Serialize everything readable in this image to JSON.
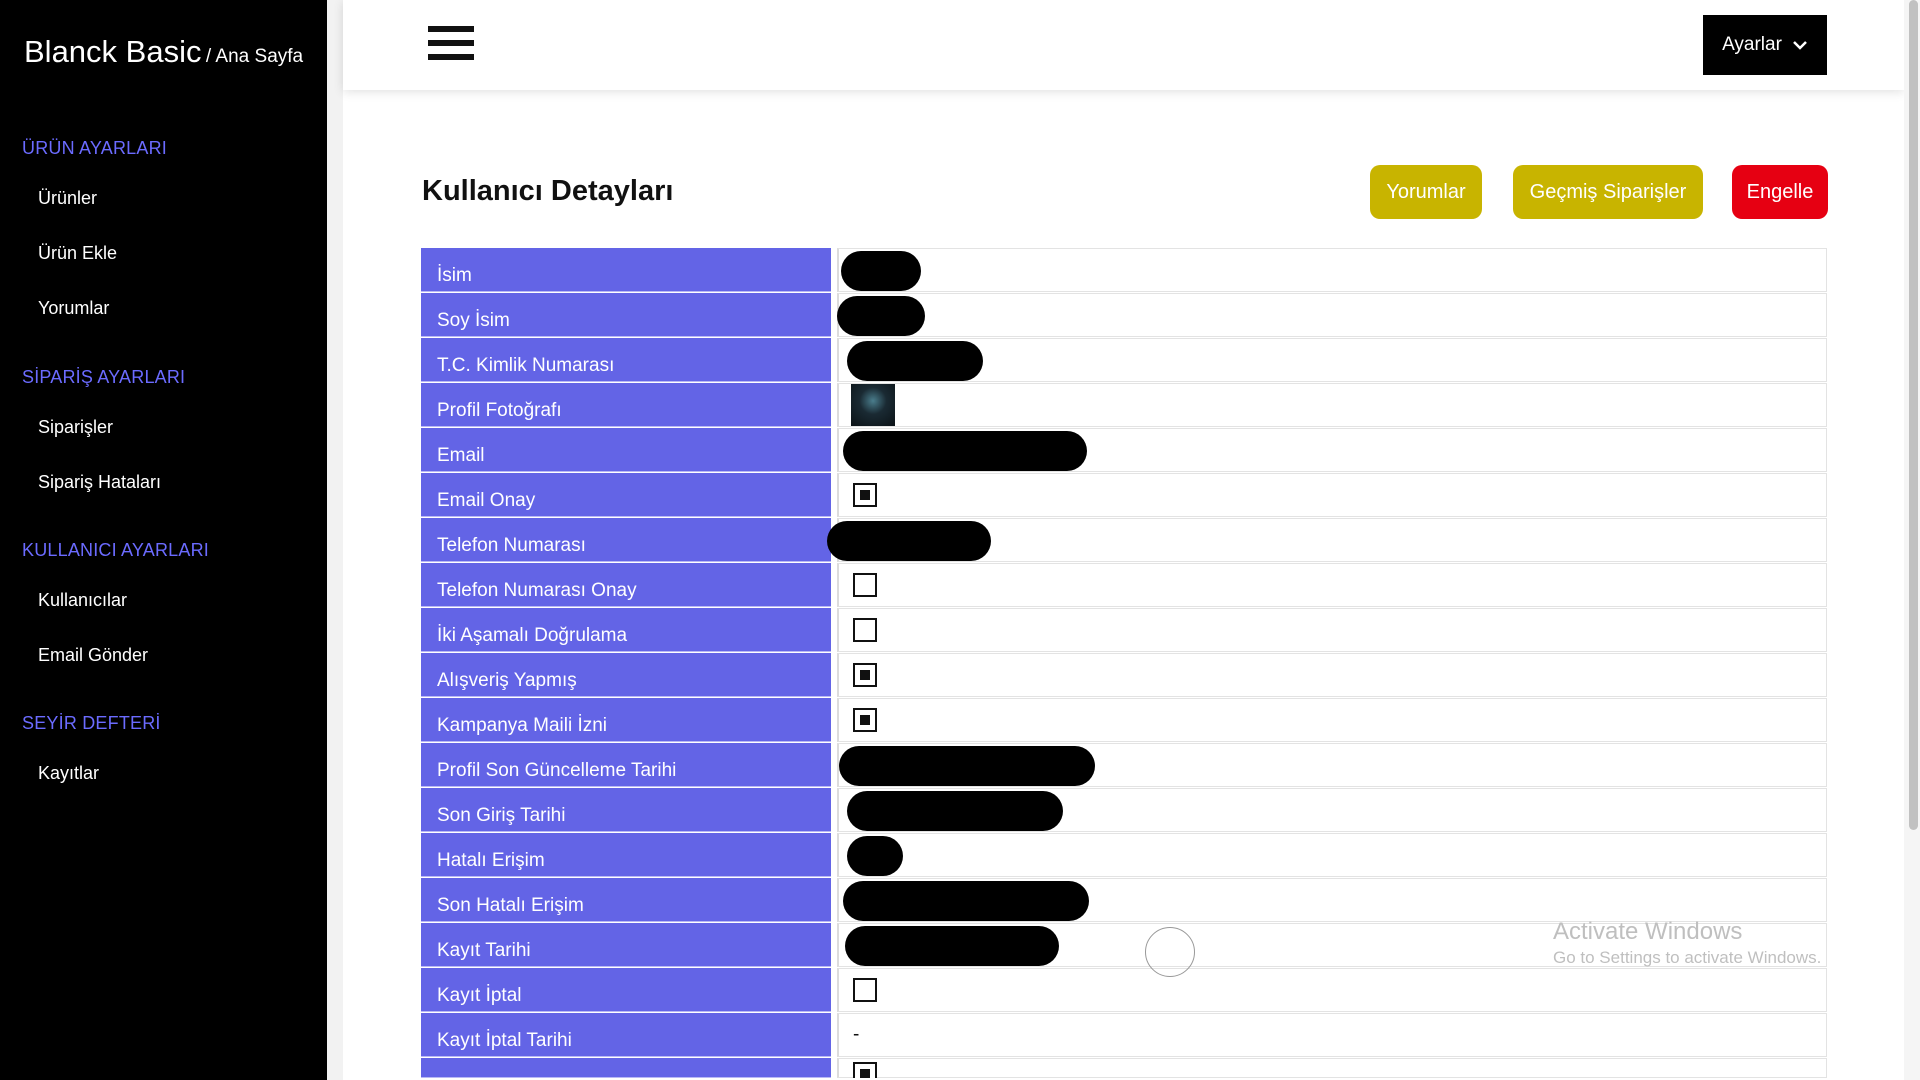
{
  "sidebar": {
    "brand_title": "Blanck Basic",
    "brand_sub": "/ Ana Sayfa",
    "sections": [
      {
        "title": "ÜRÜN AYARLARI",
        "items": [
          "Ürünler",
          "Ürün Ekle",
          "Yorumlar"
        ]
      },
      {
        "title": "SİPARİŞ AYARLARI",
        "items": [
          "Siparişler",
          "Sipariş Hataları"
        ]
      },
      {
        "title": "KULLANICI AYARLARI",
        "items": [
          "Kullanıcılar",
          "Email Gönder"
        ]
      },
      {
        "title": "SEYİR DEFTERİ",
        "items": [
          "Kayıtlar"
        ]
      }
    ]
  },
  "topbar": {
    "settings_label": "Ayarlar"
  },
  "page": {
    "title": "Kullanıcı Detayları",
    "buttons": {
      "comments": "Yorumlar",
      "past_orders": "Geçmiş Siparişler",
      "block": "Engelle"
    }
  },
  "details": [
    {
      "label": "İsim",
      "type": "redacted"
    },
    {
      "label": "Soy İsim",
      "type": "redacted"
    },
    {
      "label": "T.C. Kimlik Numarası",
      "type": "redacted"
    },
    {
      "label": "Profil Fotoğrafı",
      "type": "image"
    },
    {
      "label": "Email",
      "type": "redacted"
    },
    {
      "label": "Email Onay",
      "type": "checkbox",
      "checked": true
    },
    {
      "label": "Telefon Numarası",
      "type": "redacted"
    },
    {
      "label": "Telefon Numarası Onay",
      "type": "checkbox",
      "checked": false
    },
    {
      "label": "İki Aşamalı Doğrulama",
      "type": "checkbox",
      "checked": false
    },
    {
      "label": "Alışveriş Yapmış",
      "type": "checkbox",
      "checked": true
    },
    {
      "label": "Kampanya Maili İzni",
      "type": "checkbox",
      "checked": true
    },
    {
      "label": "Profil Son Güncelleme Tarihi",
      "type": "redacted"
    },
    {
      "label": "Son Giriş Tarihi",
      "type": "redacted"
    },
    {
      "label": "Hatalı Erişim",
      "type": "redacted"
    },
    {
      "label": "Son Hatalı Erişim",
      "type": "redacted"
    },
    {
      "label": "Kayıt Tarihi",
      "type": "redacted"
    },
    {
      "label": "Kayıt İptal",
      "type": "checkbox",
      "checked": false
    },
    {
      "label": "Kayıt İptal Tarihi",
      "type": "text",
      "value": "-"
    }
  ],
  "watermark": {
    "title": "Activate Windows",
    "sub": "Go to Settings to activate Windows."
  },
  "colors": {
    "sidebar_bg": "#000000",
    "section_title": "#6b6bff",
    "label_bg": "#6364e6",
    "button_yellow": "#c8b400",
    "button_red": "#e60012"
  }
}
